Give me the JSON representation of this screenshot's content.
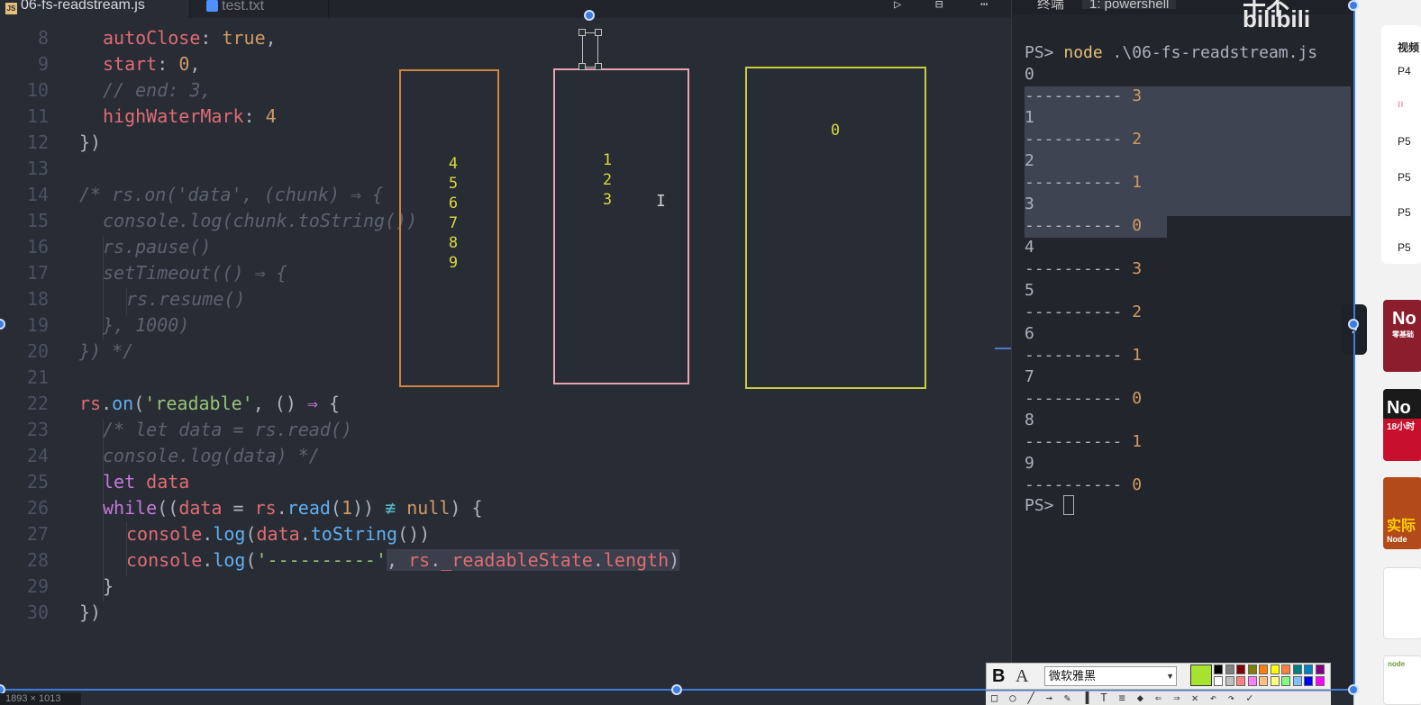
{
  "tabs": [
    {
      "label": "06-fs-readstream.js",
      "icon": "js-file-icon",
      "active": true
    },
    {
      "label": "test.txt",
      "icon": "text-file-icon",
      "active": false
    }
  ],
  "editor": {
    "lines": [
      {
        "num": "8"
      },
      {
        "num": "9"
      },
      {
        "num": "10"
      },
      {
        "num": "11"
      },
      {
        "num": "12"
      },
      {
        "num": "13"
      },
      {
        "num": "14"
      },
      {
        "num": "15"
      },
      {
        "num": "16"
      },
      {
        "num": "17"
      },
      {
        "num": "18"
      },
      {
        "num": "19"
      },
      {
        "num": "20"
      },
      {
        "num": "21"
      },
      {
        "num": "22"
      },
      {
        "num": "23"
      },
      {
        "num": "24"
      },
      {
        "num": "25"
      },
      {
        "num": "26"
      },
      {
        "num": "27"
      },
      {
        "num": "28"
      },
      {
        "num": "29"
      },
      {
        "num": "30"
      }
    ],
    "code": {
      "l8_key": "autoClose",
      "l8_colon": ": ",
      "l8_val": "true",
      "l8_end": ",",
      "l9_key": "start",
      "l9_colon": ": ",
      "l9_val": "0",
      "l9_end": ",",
      "l10": "// end: 3,",
      "l11_key": "highWaterMark",
      "l11_colon": ": ",
      "l11_val": "4",
      "l12": "})",
      "l14": "/* rs.on('data', (chunk) ⇒ {",
      "l15": "console.log(chunk.toString())",
      "l16": "rs.pause()",
      "l17": "setTimeout(() ⇒ {",
      "l18": "rs.resume()",
      "l19": "}, 1000)",
      "l20": "}) */",
      "l22_obj": "rs",
      "l22_dot": ".",
      "l22_fn": "on",
      "l22_open": "(",
      "l22_str": "'readable'",
      "l22_rest": ", () ",
      "l22_arrow": "⇒",
      "l22_brace": " {",
      "l23": "/* let data = rs.read()",
      "l24": "console.log(data) */",
      "l25_kw": "let",
      "l25_var": " data",
      "l26_kw": "while",
      "l26_p1": "((",
      "l26_var": "data",
      "l26_eq": " = ",
      "l26_obj": "rs",
      "l26_dot": ".",
      "l26_fn": "read",
      "l26_p2": "(",
      "l26_num": "1",
      "l26_p3": ")) ",
      "l26_op": "≢",
      "l26_null": " null",
      "l26_end": ") {",
      "l27_obj": "console",
      "l27_dot": ".",
      "l27_fn": "log",
      "l27_p1": "(",
      "l27_var": "data",
      "l27_dot2": ".",
      "l27_fn2": "toString",
      "l27_end": "())",
      "l28_obj": "console",
      "l28_dot": ".",
      "l28_fn": "log",
      "l28_p1": "(",
      "l28_str": "'----------'",
      "l28_comma": ", ",
      "l28_var": "rs",
      "l28_dot2": ".",
      "l28_prop": "_readableState",
      "l28_dot3": ".",
      "l28_prop2": "length",
      "l28_end": ")",
      "l29": "}",
      "l30": "})"
    },
    "boxes": [
      {
        "color": "#d3843c",
        "numbers": "4\n5\n6\n7\n8\n9"
      },
      {
        "color": "#e7a3b4",
        "numbers": "1\n2\n3"
      },
      {
        "color": "#c9cc3f",
        "numbers": "0"
      }
    ]
  },
  "terminal": {
    "tab_title_cn": "终端",
    "tab_title": "1: powershell",
    "overlay_logo": "干不 bilibili",
    "prompt": "PS>",
    "command": "node",
    "command_arg": " .\\06-fs-readstream.js",
    "output": [
      {
        "value": "0",
        "dashes": "----------",
        "count": "3"
      },
      {
        "value": "1",
        "dashes": "----------",
        "count": "2"
      },
      {
        "value": "2",
        "dashes": "----------",
        "count": "1"
      },
      {
        "value": "3",
        "dashes": "----------",
        "count": "0"
      },
      {
        "value": "4",
        "dashes": "----------",
        "count": "3"
      },
      {
        "value": "5",
        "dashes": "----------",
        "count": "2"
      },
      {
        "value": "6",
        "dashes": "----------",
        "count": "1"
      },
      {
        "value": "7",
        "dashes": "----------",
        "count": "0"
      },
      {
        "value": "8",
        "dashes": "----------",
        "count": "1"
      },
      {
        "value": "9",
        "dashes": "----------",
        "count": "0"
      }
    ],
    "final_prompt": "PS>"
  },
  "sidebar": {
    "header": "视频",
    "items": [
      "P4",
      "P5",
      "P5",
      "P5",
      "P5",
      "P5"
    ],
    "thumbs": [
      {
        "title": "No",
        "sub": "零基础",
        "bg": "#8b1d2c"
      },
      {
        "title": "No",
        "sub": "18小时",
        "bg": "#c8102e"
      },
      {
        "title": "实际",
        "sub": "Node",
        "bg": "#b34a1a"
      },
      {
        "title": "",
        "sub": "",
        "bg": "#ffffff"
      },
      {
        "title": "node",
        "sub": "",
        "bg": "#ffffff"
      }
    ]
  },
  "drawing_toolbar": {
    "bold": "B",
    "font_style": "A",
    "font_name": "微软雅黑",
    "current_color": "#a6e22e",
    "swatches": [
      "#000000",
      "#808080",
      "#800000",
      "#808000",
      "#ff8000",
      "#ffff00",
      "#ff8040",
      "#008080",
      "#0080c0",
      "#800080",
      "#ffffff",
      "#c0c0c0",
      "#ff8080",
      "#ff80ff",
      "#ffc080",
      "#ffff80",
      "#80ff80",
      "#80c0ff",
      "#0000ff",
      "#ff00ff"
    ],
    "lower_icons": "□○╱→✎▐T≡◆⇐⇒✕↶↷✓"
  },
  "dimension_label": "1893 × 1013"
}
